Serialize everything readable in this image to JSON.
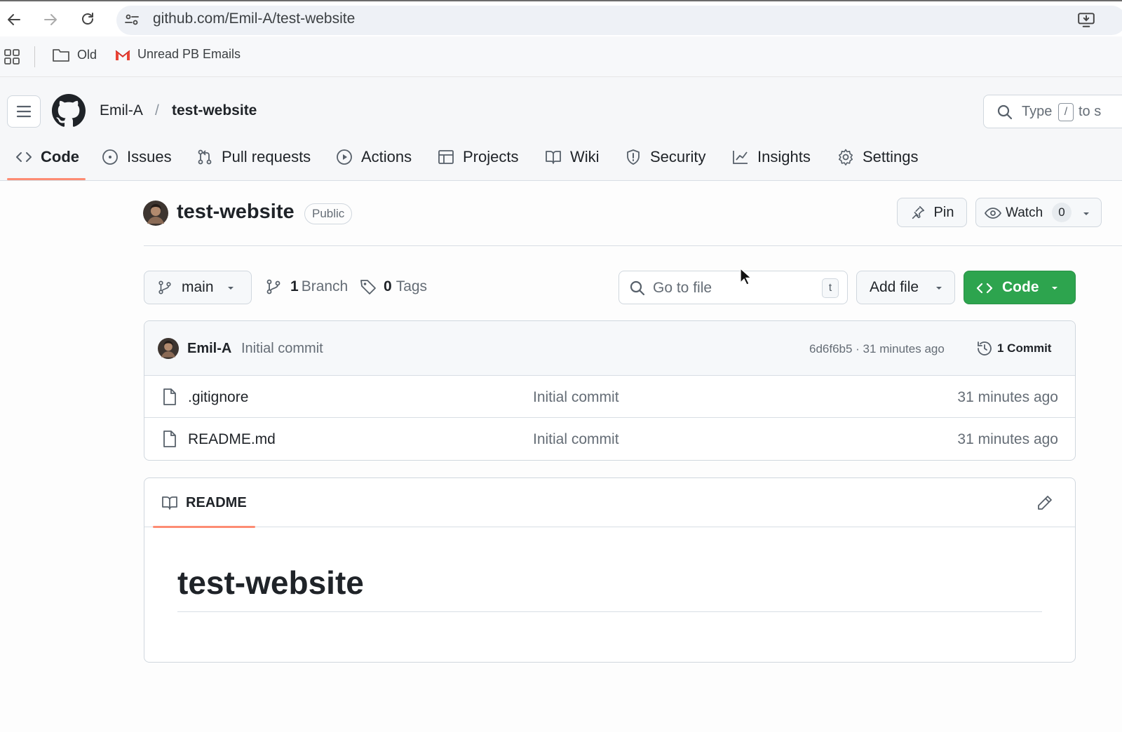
{
  "browser": {
    "url": "github.com/Emil-A/test-website",
    "bookmarks": [
      {
        "label": "Old"
      },
      {
        "label": "Unread PB Emails"
      }
    ]
  },
  "header": {
    "owner": "Emil-A",
    "separator": "/",
    "repo": "test-website",
    "search_prefix": "Type",
    "search_key": "/",
    "search_suffix": "to s"
  },
  "tabs": [
    {
      "label": "Code",
      "icon": "code-icon",
      "active": true
    },
    {
      "label": "Issues",
      "icon": "issue-icon"
    },
    {
      "label": "Pull requests",
      "icon": "pull-request-icon"
    },
    {
      "label": "Actions",
      "icon": "play-icon"
    },
    {
      "label": "Projects",
      "icon": "table-icon"
    },
    {
      "label": "Wiki",
      "icon": "book-icon"
    },
    {
      "label": "Security",
      "icon": "shield-icon"
    },
    {
      "label": "Insights",
      "icon": "graph-icon"
    },
    {
      "label": "Settings",
      "icon": "gear-icon"
    }
  ],
  "repo": {
    "name": "test-website",
    "visibility": "Public",
    "pin_label": "Pin",
    "watch_label": "Watch",
    "watch_count": "0"
  },
  "toolbar": {
    "branch": "main",
    "branch_count": "1",
    "branch_label": "Branch",
    "tag_count": "0",
    "tag_label": "Tags",
    "goto_placeholder": "Go to file",
    "goto_key": "t",
    "add_file": "Add file",
    "code": "Code"
  },
  "commit": {
    "author": "Emil-A",
    "message": "Initial commit",
    "meta": "6d6f6b5 · 31 minutes ago",
    "count_label": "1 Commit"
  },
  "files": [
    {
      "name": ".gitignore",
      "message": "Initial commit",
      "age": "31 minutes ago"
    },
    {
      "name": "README.md",
      "message": "Initial commit",
      "age": "31 minutes ago"
    }
  ],
  "readme": {
    "tab_label": "README",
    "heading": "test-website"
  },
  "colors": {
    "accent_underline": "#fd8c73",
    "code_button": "#2da44e"
  }
}
